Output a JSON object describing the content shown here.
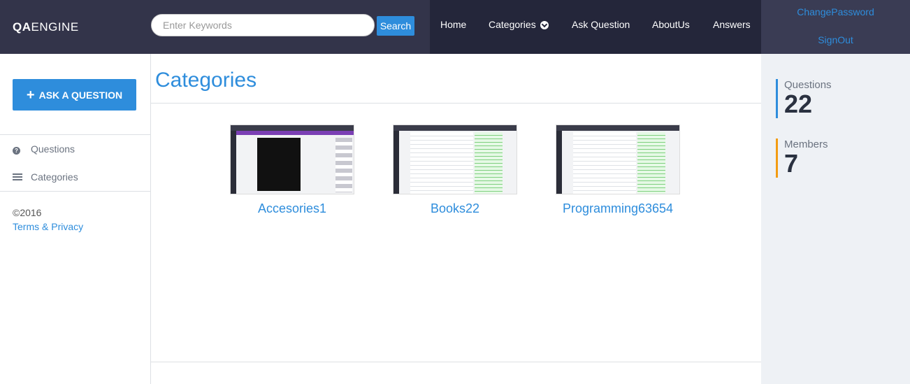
{
  "header": {
    "logo_bold": "QA",
    "logo_light": "ENGINE",
    "search_placeholder": "Enter Keywords",
    "search_button": "Search"
  },
  "nav": {
    "items": [
      "Home",
      "Categories",
      "Ask Question",
      "AboutUs",
      "Answers"
    ]
  },
  "account": {
    "change_password": "ChangePassword",
    "sign_out": "SignOut"
  },
  "sidebar": {
    "ask_button": "ASK A QUESTION",
    "links": [
      "Questions",
      "Categories"
    ],
    "copyright": "©2016",
    "terms": "Terms & Privacy"
  },
  "main": {
    "title": "Categories",
    "categories": [
      {
        "name": "Accesories1"
      },
      {
        "name": "Books22"
      },
      {
        "name": "Programming63654"
      }
    ]
  },
  "stats": [
    {
      "label": "Questions",
      "value": "22",
      "color": "#2e8ddc"
    },
    {
      "label": "Members",
      "value": "7",
      "color": "#f39c12"
    }
  ]
}
